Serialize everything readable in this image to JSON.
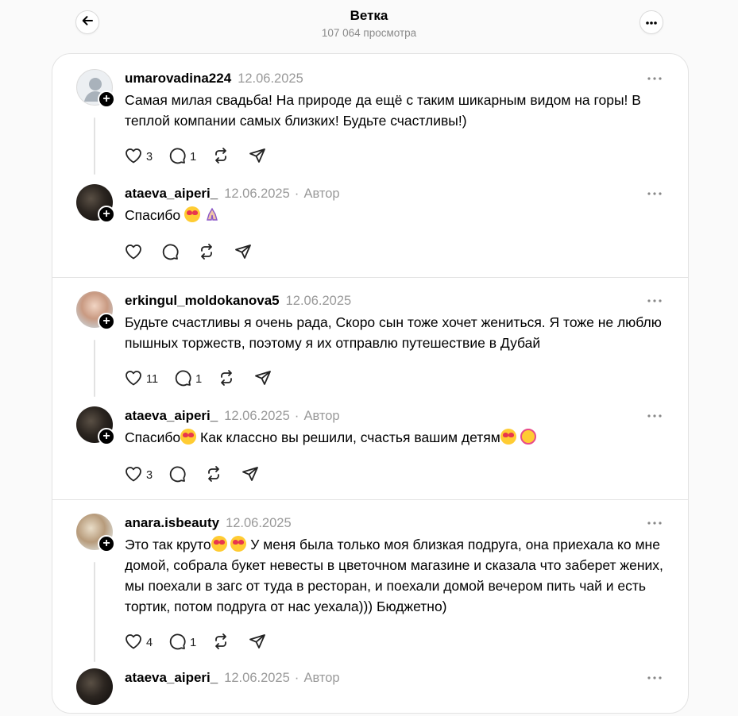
{
  "header": {
    "title": "Ветка",
    "views": "107 064 просмотра"
  },
  "posts": [
    {
      "username": "umarovadina224",
      "date": "12.06.2025",
      "author_label": "",
      "text": "Самая милая свадьба! На природе да ещё с таким шикарным видом на горы! В теплой компании самых близких! Будьте счастливы!)",
      "likes": "3",
      "replies": "1",
      "avatar": "default"
    },
    {
      "username": "ataeva_aiperi_",
      "date": "12.06.2025",
      "author_label": "Автор",
      "text": "Спасибо",
      "emojis": [
        "smiling-face-with-heart-eyes",
        "folded-hands"
      ],
      "likes": "",
      "replies": "",
      "avatar": "dark"
    },
    {
      "username": "erkingul_moldokanova5",
      "date": "12.06.2025",
      "author_label": "",
      "text": "Будьте счастливы я очень рада, Скоро сын тоже хочет жениться. Я тоже не люблю пышных торжеств, поэтому я их отправлю путешествие в Дубай",
      "likes": "11",
      "replies": "1",
      "avatar": "light"
    },
    {
      "username": "ataeva_aiperi_",
      "date": "12.06.2025",
      "author_label": "Автор",
      "text_a": "Спасибо",
      "text_b": " Как классно вы решили, счастья вашим детям",
      "emojis": [
        "smiling-face-with-hearts",
        "smiling-face-with-hearts",
        "partying-face"
      ],
      "likes": "3",
      "replies": "",
      "avatar": "dark"
    },
    {
      "username": "anara.isbeauty",
      "date": "12.06.2025",
      "author_label": "",
      "text_a": "Это так круто",
      "text_b": " У меня была только моя близкая подруга, она приехала ко мне домой, собрала букет невесты в цветочном магазине и сказала что заберет жених, мы поехали в загс от туда в ресторан, и поехали домой вечером пить чай и есть тортик, потом подруга от нас уехала))) Бюджетно)",
      "emojis": [
        "smiling-face-with-hearts",
        "smiling-face-with-heart-eyes"
      ],
      "likes": "4",
      "replies": "1",
      "avatar": "lightgirl"
    },
    {
      "username": "ataeva_aiperi_",
      "date": "12.06.2025",
      "author_label": "Автор",
      "avatar": "dark"
    }
  ],
  "icons": {
    "back": "arrow-left-icon",
    "more": "more-horizontal-icon",
    "like": "heart-icon",
    "reply": "comment-icon",
    "repost": "repost-icon",
    "share": "send-icon"
  },
  "colors": {
    "background": "#fafafa",
    "card": "#ffffff",
    "muted": "#999999",
    "divider": "#e3e3e3"
  }
}
